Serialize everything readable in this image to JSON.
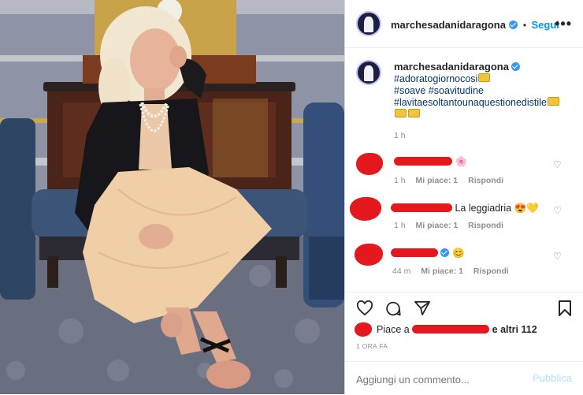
{
  "post": {
    "username": "marchesadanidaragona",
    "follow_label": "Segui",
    "separator": "•",
    "more_icon": "•••"
  },
  "caption": {
    "username": "marchesadanidaragona",
    "hashtags": [
      "#adoratogiornocosi",
      "#soave",
      "#soavitudine",
      "#lavitaesoltantounaquestionedistile"
    ],
    "time": "1 h"
  },
  "comments": [
    {
      "text": "",
      "emoji": "🌸",
      "time": "1 h",
      "likes": "Mi piace: 1",
      "reply": "Rispondi"
    },
    {
      "text": "La leggiadria",
      "emoji": "😍💛",
      "time": "1 h",
      "likes": "Mi piace: 1",
      "reply": "Rispondi"
    },
    {
      "text": "",
      "emoji": "😊",
      "time": "44 m",
      "likes": "Mi piace: 1",
      "reply": "Rispondi"
    }
  ],
  "likes": {
    "prefix": "Piace a",
    "suffix": "e altri 112",
    "suffix_plain": "e altri",
    "count": "112"
  },
  "post_time": "1 ORA FA",
  "add_comment": {
    "placeholder": "Aggiungi un commento...",
    "publish": "Pubblica"
  },
  "colors": {
    "link": "#00376b",
    "follow": "#0095f6",
    "meta": "#8e8e8e",
    "redaction": "#e5181d"
  }
}
